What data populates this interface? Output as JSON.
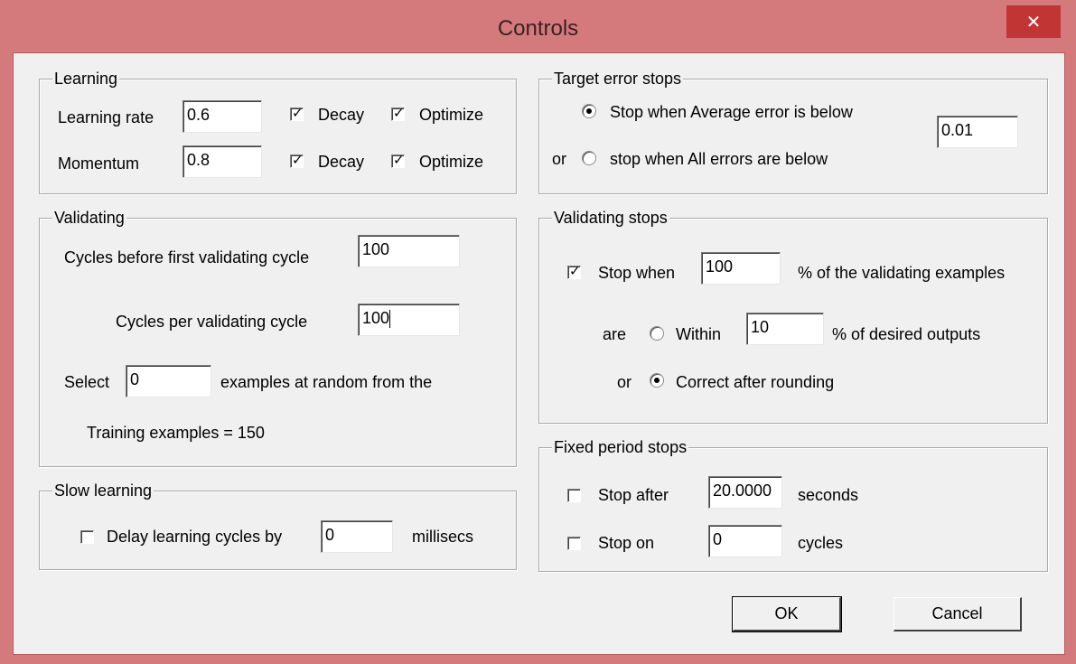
{
  "window": {
    "title": "Controls",
    "close_glyph": "✕"
  },
  "learning": {
    "title": "Learning",
    "rate_label": "Learning rate",
    "rate_value": "0.6",
    "momentum_label": "Momentum",
    "momentum_value": "0.8",
    "decay_label": "Decay",
    "optimize_label": "Optimize",
    "rate_decay": true,
    "rate_optimize": true,
    "momentum_decay": true,
    "momentum_optimize": true
  },
  "validating": {
    "title": "Validating",
    "cycles_before_label": "Cycles before first validating cycle",
    "cycles_before_value": "100",
    "cycles_per_label": "Cycles per validating cycle",
    "cycles_per_value": "100",
    "select_label": "Select",
    "select_value": "0",
    "select_suffix": "examples at random from the",
    "training_examples": "Training examples = 150"
  },
  "slow_learning": {
    "title": "Slow learning",
    "delay_label": "Delay learning cycles by",
    "delay_value": "0",
    "delay_unit": "millisecs",
    "delay_checked": false
  },
  "target_error": {
    "title": "Target error stops",
    "average_label": "Stop when Average error is below",
    "or_label": "or",
    "all_label": "stop when All errors are below",
    "value": "0.01",
    "selected": "average"
  },
  "validating_stops": {
    "title": "Validating stops",
    "stop_when_label": "Stop when",
    "stop_when_value": "100",
    "stop_when_checked": true,
    "percent_label": "% of the validating examples",
    "are_label": "are",
    "within_label": "Within",
    "within_value": "10",
    "desired_label": "% of desired outputs",
    "or_label": "or",
    "correct_label": "Correct after rounding",
    "selected": "correct"
  },
  "fixed_period": {
    "title": "Fixed period stops",
    "stop_after_label": "Stop after",
    "stop_after_value": "20.0000",
    "seconds_label": "seconds",
    "stop_after_checked": false,
    "stop_on_label": "Stop on",
    "stop_on_value": "0",
    "cycles_label": "cycles",
    "stop_on_checked": false
  },
  "buttons": {
    "ok": "OK",
    "cancel": "Cancel"
  },
  "icons": {
    "check": "✓"
  }
}
